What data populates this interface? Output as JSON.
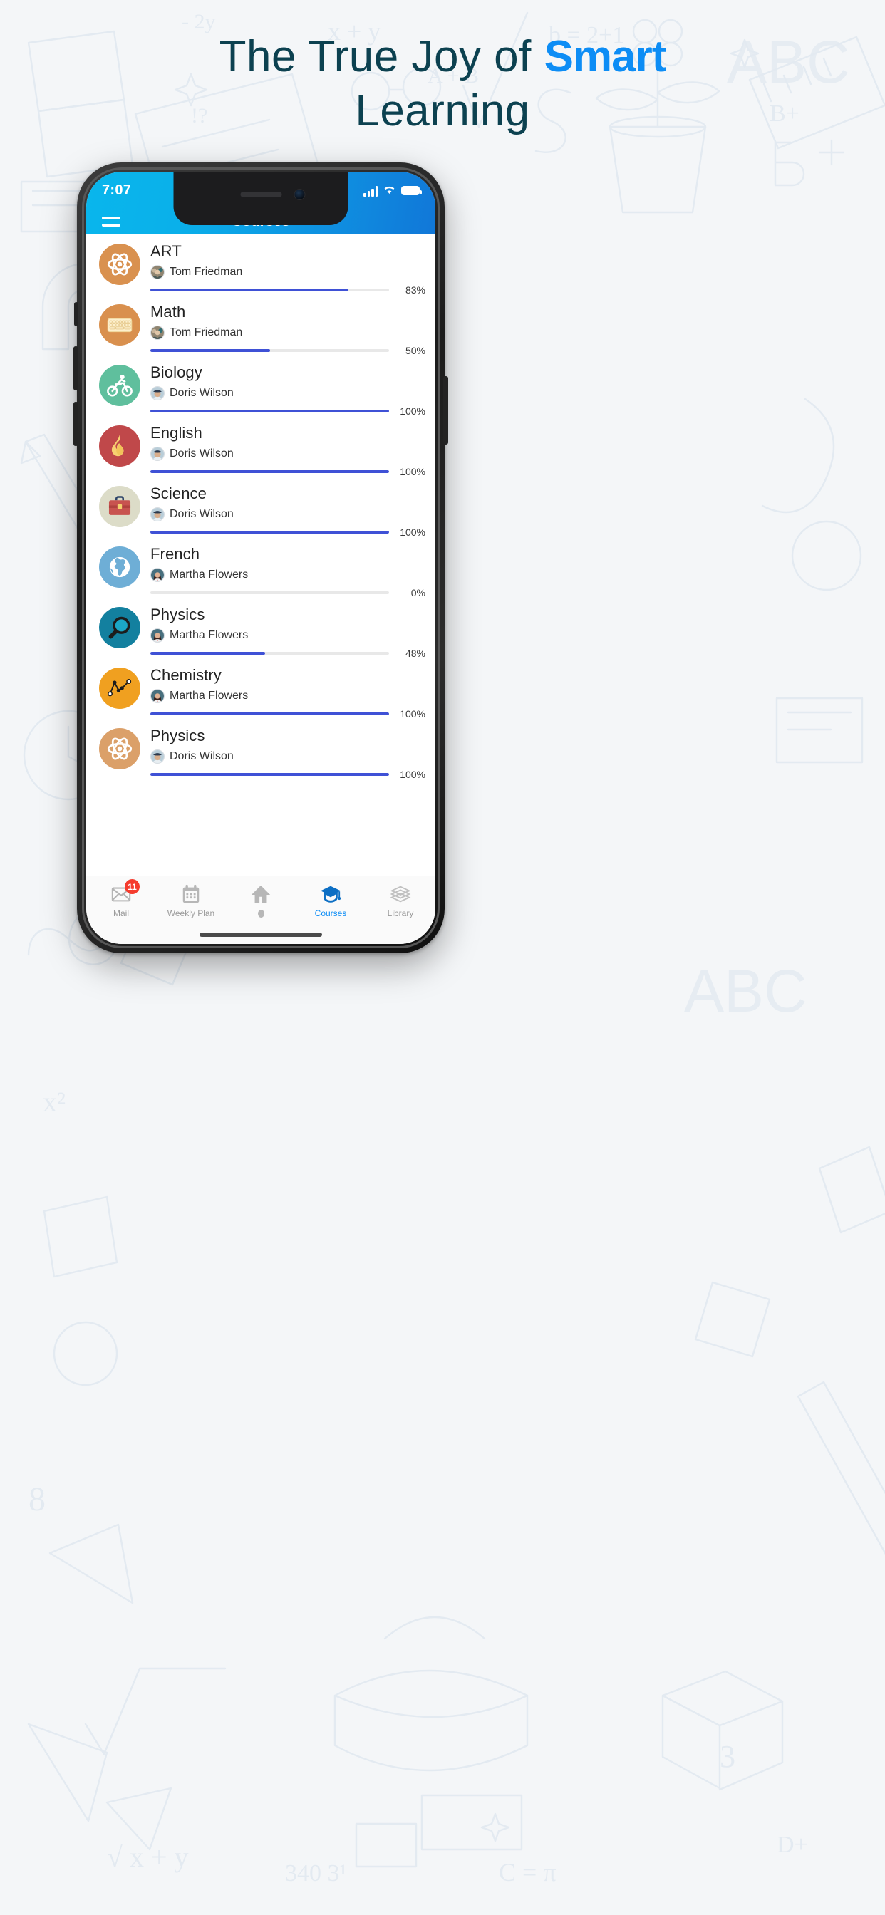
{
  "hero": {
    "line1_before": "The True Joy of ",
    "line1_highlight": "Smart",
    "line2": "Learning",
    "highlight_color": "#0d8df5",
    "text_color": "#0c4150"
  },
  "phone": {
    "status_bar": {
      "time": "7:07",
      "signal_icon": "cellular-signal-icon",
      "wifi_icon": "wifi-icon",
      "battery_icon": "battery-full-icon"
    },
    "app_bar": {
      "menu_icon": "hamburger-menu-icon",
      "title": "Courses",
      "gradient_start": "#09b6ec",
      "gradient_end": "#1177d8"
    },
    "courses": [
      {
        "title": "ART",
        "teacher": "Tom Friedman",
        "percent": "83%",
        "progress": 83,
        "icon": "atom-icon",
        "icon_bg": "#d9914f",
        "avatar": "group-photo-avatar"
      },
      {
        "title": "Math",
        "teacher": "Tom Friedman",
        "percent": "50%",
        "progress": 50,
        "icon": "keyboard-icon",
        "icon_bg": "#d9904e",
        "avatar": "group-photo-avatar"
      },
      {
        "title": "Biology",
        "teacher": "Doris Wilson",
        "percent": "100%",
        "progress": 100,
        "icon": "cyclist-icon",
        "icon_bg": "#5fbf9d",
        "avatar": "man-cap-avatar"
      },
      {
        "title": "English",
        "teacher": "Doris Wilson",
        "percent": "100%",
        "progress": 100,
        "icon": "flame-icon",
        "icon_bg": "#c0484a",
        "avatar": "man-cap-avatar"
      },
      {
        "title": "Science",
        "teacher": "Doris Wilson",
        "percent": "100%",
        "progress": 100,
        "icon": "briefcase-icon",
        "icon_bg": "#dcdcc8",
        "avatar": "man-cap-avatar"
      },
      {
        "title": "French",
        "teacher": "Martha Flowers",
        "percent": "0%",
        "progress": 0,
        "icon": "globe-icon",
        "icon_bg": "#6eaed6",
        "avatar": "woman-avatar"
      },
      {
        "title": "Physics",
        "teacher": "Martha Flowers",
        "percent": "48%",
        "progress": 48,
        "icon": "magnifier-icon",
        "icon_bg": "#13809f",
        "avatar": "woman-avatar"
      },
      {
        "title": "Chemistry",
        "teacher": "Martha Flowers",
        "percent": "100%",
        "progress": 100,
        "icon": "line-chart-icon",
        "icon_bg": "#f0a020",
        "avatar": "woman-avatar"
      },
      {
        "title": "Physics",
        "teacher": "Doris Wilson",
        "percent": "100%",
        "progress": 100,
        "icon": "atom-icon",
        "icon_bg": "#dba069",
        "avatar": "man-cap-avatar"
      }
    ],
    "bottom_nav": {
      "active_color": "#0d8df5",
      "items": [
        {
          "label": "Mail",
          "icon": "mail-icon",
          "badge": "11",
          "active": false
        },
        {
          "label": "Weekly Plan",
          "icon": "calendar-icon",
          "badge": "",
          "active": false
        },
        {
          "label": "",
          "icon": "home-icon",
          "badge": "",
          "active": false
        },
        {
          "label": "Courses",
          "icon": "graduation-cap-icon",
          "badge": "",
          "active": true
        },
        {
          "label": "Library",
          "icon": "books-icon",
          "badge": "",
          "active": false
        }
      ]
    }
  }
}
